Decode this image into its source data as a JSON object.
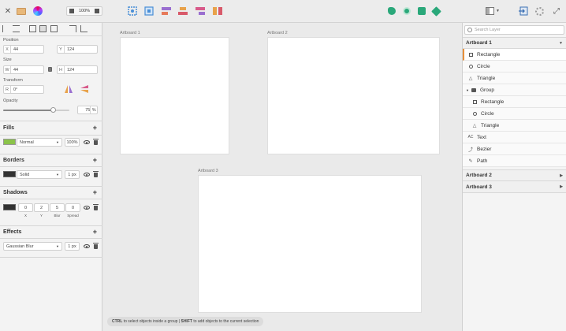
{
  "toolbar": {
    "zoom": "100%",
    "icons": [
      "close-icon",
      "folder-icon",
      "color-picker-icon",
      "zoom-out-icon",
      "zoom-in-icon",
      "boolean-icon",
      "artboard-fit-icon",
      "align-top-icon",
      "align-middle-icon",
      "align-bottom-icon",
      "green-shape-icon",
      "green-circle-icon",
      "green-square-icon",
      "green-pen-icon",
      "layout-icon",
      "export-icon",
      "settings-icon",
      "fullscreen-icon"
    ]
  },
  "left": {
    "position_label": "Position",
    "x_prefix": "X",
    "x_value": "44",
    "y_prefix": "Y",
    "y_value": "124",
    "size_label": "Size",
    "w_prefix": "W",
    "w_value": "44",
    "h_prefix": "H",
    "h_value": "124",
    "transform_label": "Transform",
    "r_prefix": "R",
    "r_value": "0°",
    "opacity_label": "Opacity",
    "opacity_value": "75",
    "opacity_unit": "%",
    "opacity_fraction": 0.75,
    "fills": {
      "title": "Fills",
      "blend": "Normal",
      "percent": "100%",
      "color": "#8bc34a"
    },
    "borders": {
      "title": "Borders",
      "style": "Solid",
      "size": "1 px",
      "color": "#333333"
    },
    "shadows": {
      "title": "Shadows",
      "color": "#333333",
      "values": [
        "0",
        "2",
        "5",
        "0"
      ],
      "labels": [
        "X",
        "Y",
        "Blur",
        "Spread"
      ]
    },
    "effects": {
      "title": "Effects",
      "type": "Gaussian Blur",
      "size": "1 px"
    }
  },
  "canvas": {
    "artboards": [
      "Artboard 1",
      "Artboard 2",
      "Artboard 3"
    ]
  },
  "status": {
    "ctrl": "CTRL",
    "ctrl_text": "to select objects inside a group",
    "sep": "|",
    "shift": "SHIFT",
    "shift_text": "to add objects to the current selection"
  },
  "right": {
    "search_placeholder": "Search Layer",
    "artboard1": "Artboard 1",
    "layers": [
      {
        "label": "Rectangle",
        "icon": "rectangle-icon"
      },
      {
        "label": "Circle",
        "icon": "circle-icon"
      },
      {
        "label": "Triangle",
        "icon": "triangle-icon"
      },
      {
        "label": "Group",
        "icon": "group-icon"
      },
      {
        "label": "Rectangle",
        "icon": "rectangle-icon"
      },
      {
        "label": "Circle",
        "icon": "circle-icon"
      },
      {
        "label": "Triangle",
        "icon": "triangle-icon"
      },
      {
        "label": "Text",
        "icon": "text-icon"
      },
      {
        "label": "Bezier",
        "icon": "bezier-icon"
      },
      {
        "label": "Path",
        "icon": "path-icon"
      }
    ],
    "artboard2": "Artboard 2",
    "artboard3": "Artboard 3"
  }
}
